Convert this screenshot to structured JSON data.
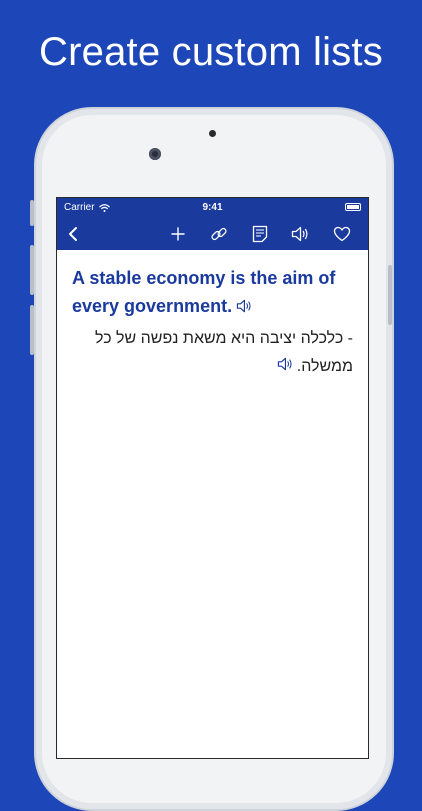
{
  "headline": "Create custom lists",
  "status": {
    "carrier": "Carrier",
    "time": "9:41"
  },
  "toolbar": {
    "icons": [
      "chevron-left-icon",
      "plus-icon",
      "link-icon",
      "note-icon",
      "speaker-icon",
      "heart-icon"
    ]
  },
  "card": {
    "sentence": "A stable economy is the aim of every government.",
    "translation": "- כלכלה יציבה היא משאת נפשה של כל ממשלה."
  },
  "colors": {
    "background": "#1d46b8",
    "bar": "#1a3a9e",
    "sentence": "#1a3a9e"
  }
}
